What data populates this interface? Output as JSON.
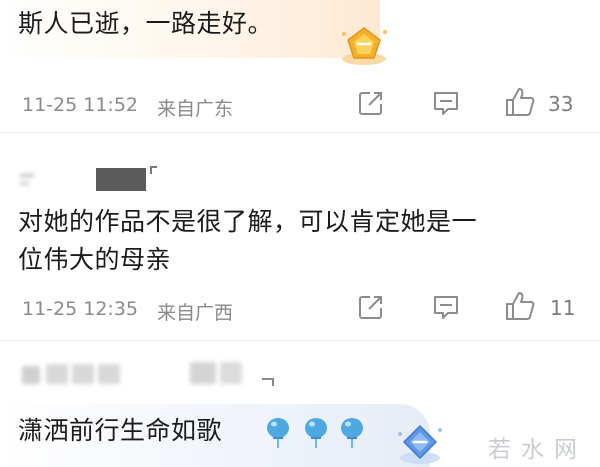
{
  "comments": [
    {
      "text": "斯人已逝，一路走好。",
      "time": "11-25 11:52",
      "source": "来自广东",
      "likes": "33"
    },
    {
      "text_line1": "对她的作品不是很了解，可以肯定她是一",
      "text_line2": "位伟大的母亲",
      "time": "11-25 12:35",
      "source": "来自广西",
      "likes": "11"
    },
    {
      "text": "潇洒前行生命如歌"
    }
  ],
  "watermark": "若水网",
  "icons": [
    "share-icon",
    "comment-icon",
    "like-icon",
    "badge-icon",
    "balloon-icon"
  ],
  "colors": {
    "meta_text": "#8a8a8a",
    "gold_badge": "#f6b52a",
    "blue_badge": "#6aa2e8",
    "balloon": "#4da8e0"
  }
}
